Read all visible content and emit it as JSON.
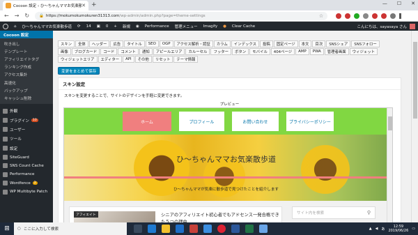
{
  "browser": {
    "tab_title": "Cocoon 設定 ‹ ひ〜ちゃんママお気楽散歩道",
    "url_host": "https://mokumokumokuren31313.com",
    "url_path": "/wp-admin/admin.php?page=theme-settings"
  },
  "adminbar": {
    "site": "ひ〜ちゃんママお気楽散歩道",
    "updates": "14",
    "comments": "0",
    "new": "新規",
    "performance": "Performance",
    "admin_menu": "管理メニュー",
    "imagify": "Imagify",
    "clear_cache": "Clear Cache",
    "greeting": "こんにちは、sayasaya さん"
  },
  "sidebar": {
    "active": "Cocoon 設定",
    "sub": [
      "吹き出し",
      "テンプレート",
      "アフィリエイトタグ",
      "ランキング作成",
      "アクセス集計",
      "高速化",
      "バックアップ",
      "キャッシュ削除"
    ],
    "main": [
      {
        "label": "外観"
      },
      {
        "label": "プラグイン",
        "badge": "10"
      },
      {
        "label": "ユーザー"
      },
      {
        "label": "ツール"
      },
      {
        "label": "設定"
      },
      {
        "label": "SiteGuard"
      },
      {
        "label": "SNS Count Cache"
      },
      {
        "label": "Performance"
      },
      {
        "label": "Wordfence",
        "badge": "2"
      },
      {
        "label": "WP Multibyte Patch"
      }
    ]
  },
  "tabs": [
    "スキン",
    "全体",
    "ヘッダー",
    "広告",
    "タイトル",
    "SEO",
    "OGP",
    "アクセス解析・認証",
    "カラム",
    "インデックス",
    "投稿",
    "固定ページ",
    "本文",
    "目次",
    "SNSシェア",
    "SNSフォロー",
    "画像",
    "ブログカード",
    "コード",
    "コメント",
    "通知",
    "アピールエリア",
    "カルーセル",
    "フッター",
    "ボタン",
    "モバイル",
    "404ページ",
    "AMP",
    "PWA",
    "管理者画面",
    "ウィジェット",
    "ウィジェットエリア",
    "エディター",
    "API",
    "その他",
    "リセット",
    "テーマ情報"
  ],
  "save_button": "変更をまとめて保存",
  "panel": {
    "heading": "スキン設定",
    "description": "スキンを変更することで、サイトのデザインを手軽に変更できます。",
    "preview_label": "プレビュー"
  },
  "preview": {
    "nav": [
      "ホーム",
      "プロフィール",
      "お問い合わせ",
      "プライバシーポリシー"
    ],
    "site_title": "ひ〜ちゃんママお気楽散歩道",
    "tagline": "ひ〜ちゃんママが気楽に散歩道で見つけたことを紹介します",
    "card_category": "アフィエイト",
    "card_title": "シニアのアフィリエイト初心者でもアドセンス一発合格できた５つの理由",
    "search_placeholder": "サイト内を検索"
  },
  "taskbar": {
    "search_text": "ここに入力して検索",
    "time": "12:59",
    "date": "2019/06/26"
  },
  "colors": {
    "admin_dark": "#23282d",
    "wp_blue": "#0073aa",
    "nav_green": "#81d742",
    "home_red": "#f07f7f"
  }
}
